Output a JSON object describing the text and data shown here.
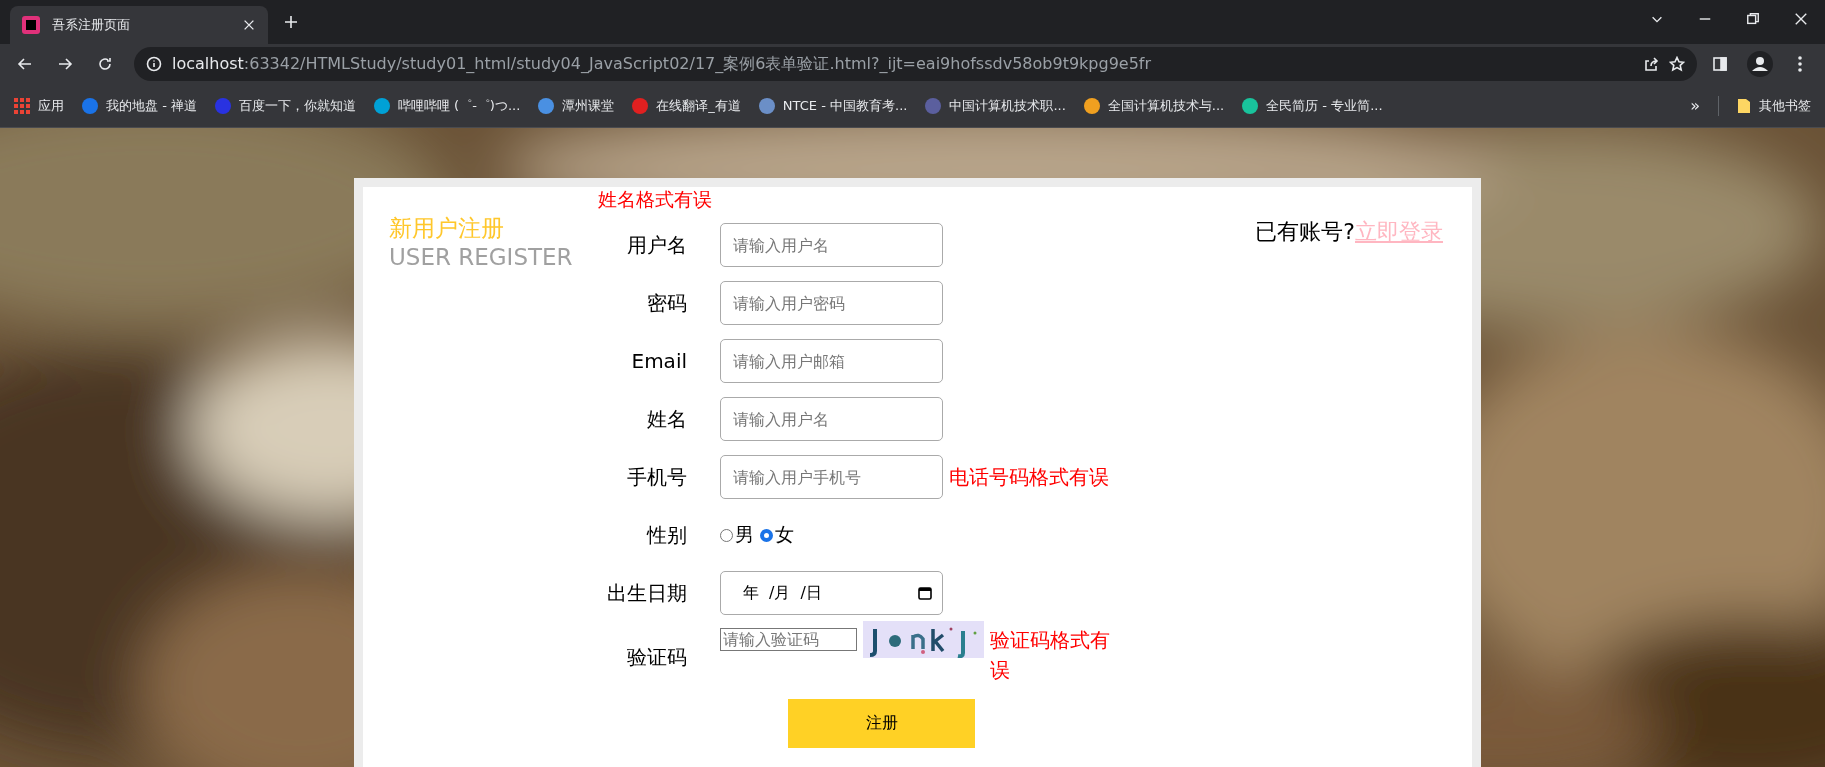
{
  "browser": {
    "tab": {
      "title": "吾系注册页面",
      "selected": true
    },
    "address": {
      "host": "localhost",
      "rest": ":63342/HTMLStudy/study01_html/study04_JavaScript02/17_案例6表单验证.html?_ijt=eai9hofssdv58ob9t9kpg9e5fr"
    },
    "bookmarks": [
      {
        "label": "应用",
        "kind": "apps",
        "color": "#ea4335"
      },
      {
        "label": "我的地盘 - 禅道",
        "kind": "site",
        "color": "#1a73e8"
      },
      {
        "label": "百度一下，你就知道",
        "kind": "site",
        "color": "#2932e1"
      },
      {
        "label": "哔哩哔哩 (゜-゜)つ...",
        "kind": "site",
        "color": "#00a1d6"
      },
      {
        "label": "潭州课堂",
        "kind": "site",
        "color": "#4a90e2"
      },
      {
        "label": "在线翻译_有道",
        "kind": "site",
        "color": "#e02020"
      },
      {
        "label": "NTCE - 中国教育考...",
        "kind": "site",
        "color": "#6b8fc7"
      },
      {
        "label": "中国计算机技术职...",
        "kind": "site",
        "color": "#5b5f9e"
      },
      {
        "label": "全国计算机技术与...",
        "kind": "site",
        "color": "#f0a020"
      },
      {
        "label": "全民简历 - 专业简...",
        "kind": "site",
        "color": "#19c39c"
      }
    ],
    "overflow": "»",
    "other_bookmarks": "其他书签"
  },
  "page": {
    "title": "新用户注册",
    "subtitle": "USER REGISTER",
    "login_prompt": "已有账号?",
    "login_link": "立即登录",
    "top_error": "姓名格式有误",
    "fields": [
      {
        "kind": "text",
        "label": "用户名",
        "placeholder": "请输入用户名"
      },
      {
        "kind": "text",
        "label": "密码",
        "placeholder": "请输入用户密码"
      },
      {
        "kind": "text",
        "label": "Email",
        "placeholder": "请输入用户邮箱"
      },
      {
        "kind": "text",
        "label": "姓名",
        "placeholder": "请输入用户名"
      },
      {
        "kind": "text",
        "label": "手机号",
        "placeholder": "请输入用户手机号",
        "error": "电话号码格式有误"
      },
      {
        "kind": "radio",
        "label": "性别",
        "options": [
          {
            "label": "男",
            "selected": false
          },
          {
            "label": "女",
            "selected": true
          }
        ]
      },
      {
        "kind": "date",
        "label": "出生日期",
        "year": "年",
        "month": "/月",
        "day": "/日"
      },
      {
        "kind": "captcha",
        "label": "验证码",
        "placeholder": "请输入验证码",
        "error": "验证码格式有误"
      }
    ],
    "submit": "注册"
  }
}
